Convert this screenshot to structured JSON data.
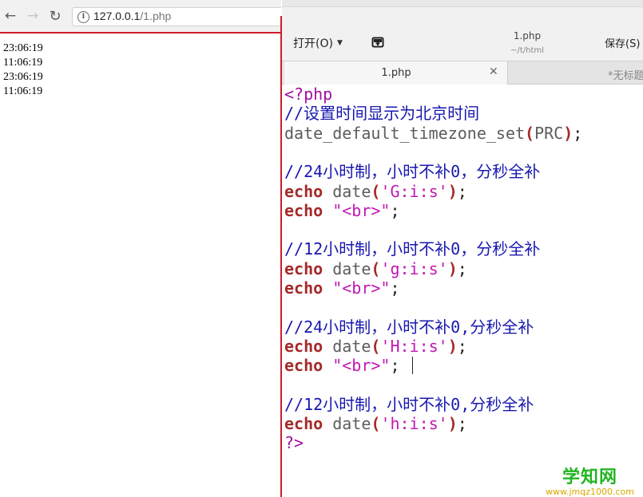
{
  "browser": {
    "url_host": "127.0.0.1",
    "url_path": "/1.php",
    "output_lines": [
      "23:06:19",
      "11:06:19",
      "23:06:19",
      "11:06:19"
    ]
  },
  "editor": {
    "open_label": "打开(O)",
    "title": "1.php",
    "subtitle": "~/t/html",
    "save_label": "保存(S)",
    "tabs": [
      {
        "label": "1.php",
        "active": true
      },
      {
        "label": "*无标题"
      }
    ],
    "code_lines": [
      [
        {
          "t": "tag",
          "s": "<?php"
        }
      ],
      [
        {
          "t": "cmt",
          "s": "//设置时间显示为北京时间"
        }
      ],
      [
        {
          "t": "fn",
          "s": "date_default_timezone_set"
        },
        {
          "t": "par",
          "s": "("
        },
        {
          "t": "fn",
          "s": "PRC"
        },
        {
          "t": "par",
          "s": ")"
        },
        {
          "t": "pl",
          "s": ";"
        }
      ],
      [],
      [
        {
          "t": "cmt",
          "s": "//24小时制，小时不补0，分秒全补"
        }
      ],
      [
        {
          "t": "kw",
          "s": "echo"
        },
        {
          "t": "pl",
          "s": " "
        },
        {
          "t": "fn",
          "s": "date"
        },
        {
          "t": "par",
          "s": "("
        },
        {
          "t": "str",
          "s": "'G:i:s'"
        },
        {
          "t": "par",
          "s": ")"
        },
        {
          "t": "pl",
          "s": ";"
        }
      ],
      [
        {
          "t": "kw",
          "s": "echo"
        },
        {
          "t": "pl",
          "s": " "
        },
        {
          "t": "str",
          "s": "\"<br>\""
        },
        {
          "t": "pl",
          "s": ";"
        }
      ],
      [],
      [
        {
          "t": "cmt",
          "s": "//12小时制，小时不补0，分秒全补"
        }
      ],
      [
        {
          "t": "kw",
          "s": "echo"
        },
        {
          "t": "pl",
          "s": " "
        },
        {
          "t": "fn",
          "s": "date"
        },
        {
          "t": "par",
          "s": "("
        },
        {
          "t": "str",
          "s": "'g:i:s'"
        },
        {
          "t": "par",
          "s": ")"
        },
        {
          "t": "pl",
          "s": ";"
        }
      ],
      [
        {
          "t": "kw",
          "s": "echo"
        },
        {
          "t": "pl",
          "s": " "
        },
        {
          "t": "str",
          "s": "\"<br>\""
        },
        {
          "t": "pl",
          "s": ";"
        }
      ],
      [],
      [
        {
          "t": "cmt",
          "s": "//24小时制，小时不补0,分秒全补"
        }
      ],
      [
        {
          "t": "kw",
          "s": "echo"
        },
        {
          "t": "pl",
          "s": " "
        },
        {
          "t": "fn",
          "s": "date"
        },
        {
          "t": "par",
          "s": "("
        },
        {
          "t": "str",
          "s": "'H:i:s'"
        },
        {
          "t": "par",
          "s": ")"
        },
        {
          "t": "pl",
          "s": ";"
        }
      ],
      [
        {
          "t": "kw",
          "s": "echo"
        },
        {
          "t": "pl",
          "s": " "
        },
        {
          "t": "str",
          "s": "\"<br>\""
        },
        {
          "t": "pl",
          "s": ";"
        }
      ],
      [],
      [
        {
          "t": "cmt",
          "s": "//12小时制，小时不补0,分秒全补"
        }
      ],
      [
        {
          "t": "kw",
          "s": "echo"
        },
        {
          "t": "pl",
          "s": " "
        },
        {
          "t": "fn",
          "s": "date"
        },
        {
          "t": "par",
          "s": "("
        },
        {
          "t": "str",
          "s": "'h:i:s'"
        },
        {
          "t": "par",
          "s": ")"
        },
        {
          "t": "pl",
          "s": ";"
        }
      ],
      [
        {
          "t": "tag",
          "s": "?>"
        }
      ]
    ]
  },
  "watermark": {
    "title": "学知网",
    "url": "www.jmqz1000.com"
  },
  "colors": {
    "accent_red": "#cf1b2b",
    "php_tag": "#a0109f",
    "comment": "#1818b0",
    "keyword": "#a52a2a",
    "string": "#c217b6",
    "watermark_green": "#22b522",
    "watermark_gold": "#d8a800"
  },
  "icons": [
    "back-arrow-icon",
    "forward-arrow-icon",
    "reload-icon",
    "info-icon",
    "caret-down-icon",
    "new-document-icon",
    "close-icon"
  ]
}
